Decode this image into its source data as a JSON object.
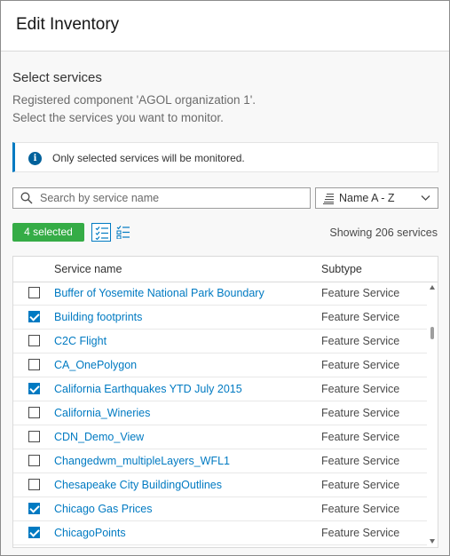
{
  "header": {
    "title": "Edit Inventory"
  },
  "section": {
    "title": "Select services",
    "line1": "Registered component 'AGOL organization 1'.",
    "line2": "Select the services you want to monitor."
  },
  "notice": {
    "icon": "info-icon",
    "text": "Only selected services will be monitored."
  },
  "search": {
    "placeholder": "Search by service name",
    "value": ""
  },
  "sort": {
    "label": "Name A - Z"
  },
  "toolbar": {
    "selected_badge": "4 selected",
    "count_text": "Showing 206 services"
  },
  "colors": {
    "accent": "#007ac2",
    "badge": "#35ac46",
    "info": "#00619b"
  },
  "table": {
    "columns": [
      "Service name",
      "Subtype"
    ],
    "rows": [
      {
        "name": "Buffer of Yosemite National Park Boundary",
        "subtype": "Feature Service",
        "checked": false
      },
      {
        "name": "Building footprints",
        "subtype": "Feature Service",
        "checked": true
      },
      {
        "name": "C2C Flight",
        "subtype": "Feature Service",
        "checked": false
      },
      {
        "name": "CA_OnePolygon",
        "subtype": "Feature Service",
        "checked": false
      },
      {
        "name": "California Earthquakes YTD July 2015",
        "subtype": "Feature Service",
        "checked": true
      },
      {
        "name": "California_Wineries",
        "subtype": "Feature Service",
        "checked": false
      },
      {
        "name": "CDN_Demo_View",
        "subtype": "Feature Service",
        "checked": false
      },
      {
        "name": "Changedwm_multipleLayers_WFL1",
        "subtype": "Feature Service",
        "checked": false
      },
      {
        "name": "Chesapeake City BuildingOutlines",
        "subtype": "Feature Service",
        "checked": false
      },
      {
        "name": "Chicago Gas Prices",
        "subtype": "Feature Service",
        "checked": true
      },
      {
        "name": "ChicagoPoints",
        "subtype": "Feature Service",
        "checked": true
      }
    ]
  }
}
